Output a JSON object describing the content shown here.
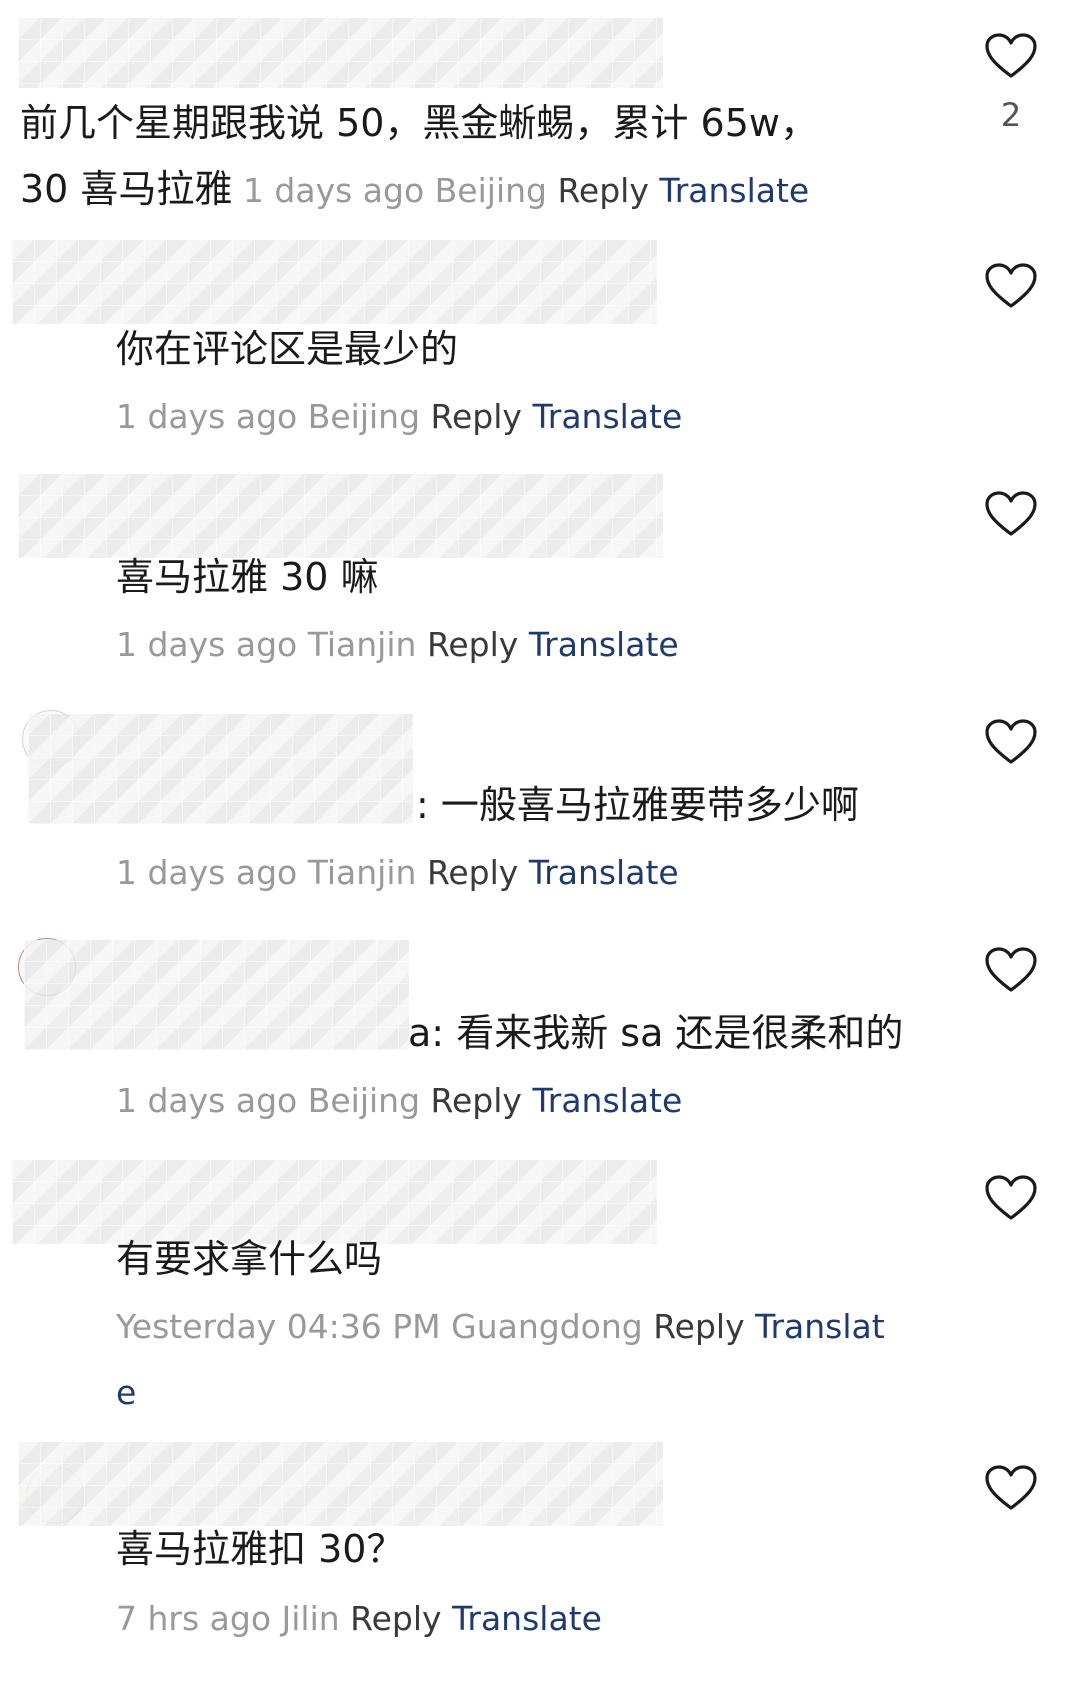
{
  "comments": [
    {
      "text_line1": "前几个星期跟我说 50，黑金蜥蜴，累计 65w，",
      "text_line2": "30 喜马拉雅",
      "time": "1 days ago",
      "location": "Beijing",
      "reply": "Reply",
      "translate": "Translate",
      "likes": "2"
    },
    {
      "text": "你在评论区是最少的",
      "time": "1 days ago",
      "location": "Beijing",
      "reply": "Reply",
      "translate": "Translate"
    },
    {
      "text": "喜马拉雅 30 嘛",
      "time": "1 days ago",
      "location": "Tianjin",
      "reply": "Reply",
      "translate": "Translate"
    },
    {
      "prefix": ":",
      "text": "一般喜马拉雅要带多少啊",
      "time": "1 days ago",
      "location": "Tianjin",
      "reply": "Reply",
      "translate": "Translate"
    },
    {
      "prefix": "a:",
      "text": "看来我新 sa 还是很柔和的",
      "time": "1 days ago",
      "location": "Beijing",
      "reply": "Reply",
      "translate": "Translate"
    },
    {
      "text": "有要求拿什么吗",
      "time": "Yesterday 04:36 PM",
      "location": "Guangdong",
      "reply": "Reply",
      "translate_line1": "Translat",
      "translate_line2": "e"
    },
    {
      "text": "喜马拉雅扣 30？",
      "time": "7 hrs ago",
      "location": "Jilin",
      "reply": "Reply",
      "translate": "Translate"
    }
  ],
  "icons": {
    "like": "heart-outline-icon"
  },
  "colors": {
    "meta_gray": "#999999",
    "translate_blue": "#1e3a6e",
    "text": "#1a1a1a"
  }
}
